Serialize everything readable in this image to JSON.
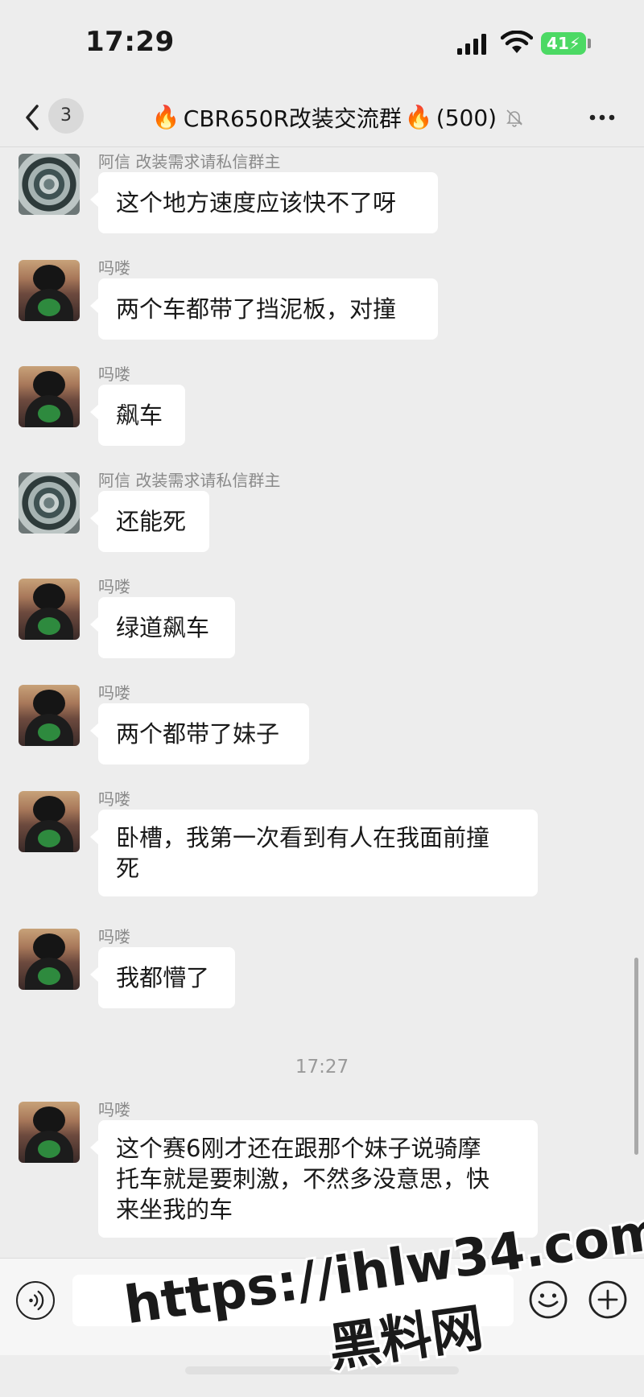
{
  "status_bar": {
    "time": "17:29",
    "battery": "41"
  },
  "header": {
    "back_icon": "chevron-left-icon",
    "unread_count": "3",
    "title_prefix_icon": "🔥",
    "title": "CBR650R改装交流群",
    "title_suffix_icon": "🔥",
    "member_count": "(500)",
    "mute_icon": "bell-off-icon",
    "more_icon": "more-icon"
  },
  "messages": [
    {
      "sender": "阿信 改装需求请私信群主",
      "avatar": "ring",
      "text": "这个地方速度应该快不了呀"
    },
    {
      "sender": "吗喽",
      "avatar": "person",
      "text": "两个车都带了挡泥板，对撞"
    },
    {
      "sender": "吗喽",
      "avatar": "person",
      "text": "飙车"
    },
    {
      "sender": "阿信 改装需求请私信群主",
      "avatar": "ring",
      "text": "还能死"
    },
    {
      "sender": "吗喽",
      "avatar": "person",
      "text": "绿道飙车"
    },
    {
      "sender": "吗喽",
      "avatar": "person",
      "text": "两个都带了妹子"
    },
    {
      "sender": "吗喽",
      "avatar": "person",
      "lines": [
        "卧槽，我第一次看到有人在我面前撞",
        "死"
      ]
    },
    {
      "sender": "吗喽",
      "avatar": "person",
      "text": "我都懵了"
    },
    {
      "sender": "吗喽",
      "avatar": "person",
      "lines": [
        "这个赛6刚才还在跟那个妹子说骑摩",
        "托车就是要刺激，不然多没意思，快",
        "来坐我的车"
      ]
    }
  ],
  "timestamp": "17:27",
  "input_bar": {
    "voice_icon": "voice-icon",
    "emoji_icon": "emoji-icon",
    "plus_icon": "plus-icon"
  },
  "watermark": {
    "line1": "https://ihlw34.com",
    "line2": "黑料网"
  },
  "colors": {
    "background": "#ededed",
    "bubble": "#ffffff",
    "battery": "#4cd964"
  }
}
